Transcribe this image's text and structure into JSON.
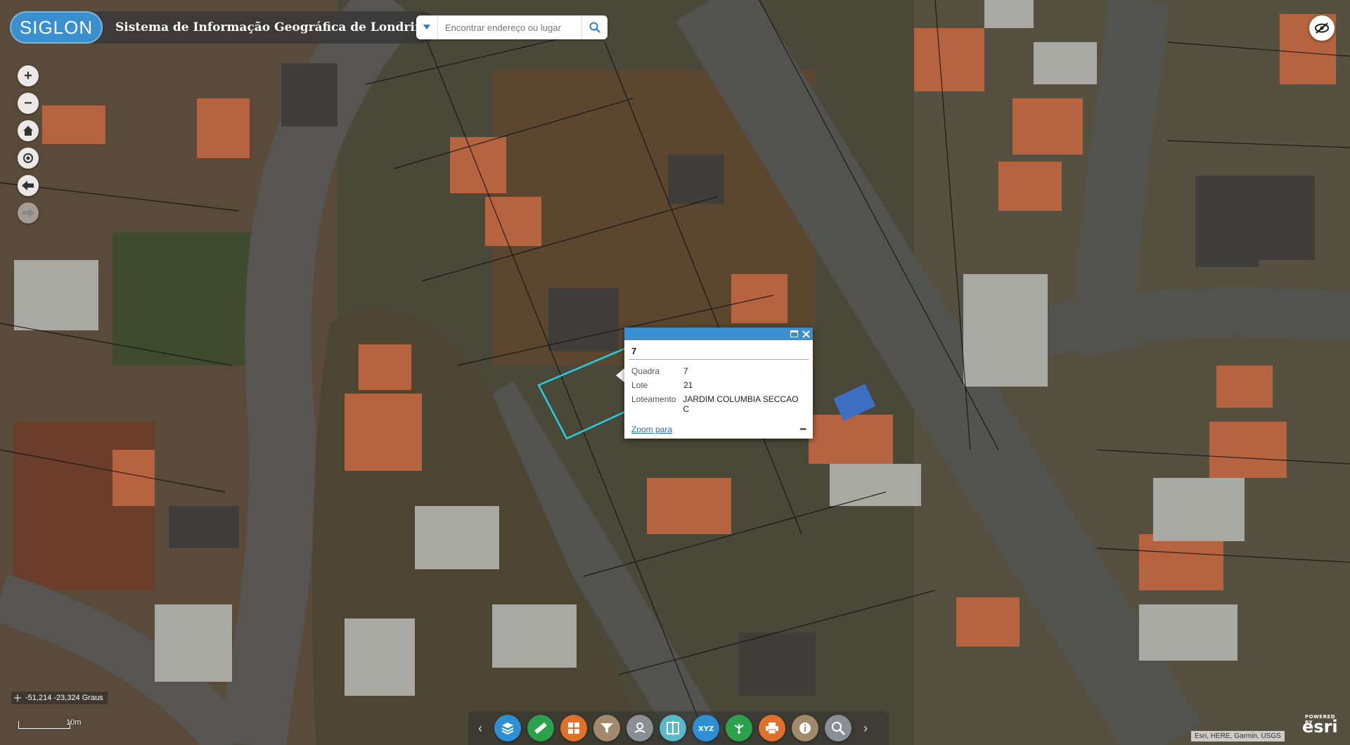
{
  "header": {
    "logo_text": "SIGLON",
    "title": "Sistema de Informação Geográfica de Londrina"
  },
  "search": {
    "placeholder": "Encontrar endereço ou lugar"
  },
  "map_tools": {
    "zoom_in": "+",
    "zoom_out": "−",
    "home": "home-icon",
    "locate": "locate-icon",
    "back": "back-icon",
    "forward": "forward-icon"
  },
  "popup": {
    "title": "7",
    "fields": [
      {
        "label": "Quadra",
        "value": "7"
      },
      {
        "label": "Lote",
        "value": "21"
      },
      {
        "label": "Loteamento",
        "value": "JARDIM COLUMBIA SECCAO C"
      }
    ],
    "zoom_link": "Zoom para",
    "more": "•••"
  },
  "coordinates": "-51,214 -23,324 Graus",
  "scale_label": "10m",
  "toolbar": {
    "buttons": [
      {
        "icon": "layers-icon",
        "color": "#2f8fd4"
      },
      {
        "icon": "ruler-icon",
        "color": "#2aa14a"
      },
      {
        "icon": "basemap-grid-icon",
        "color": "#e0702a"
      },
      {
        "icon": "filter-icon",
        "color": "#a08a6a"
      },
      {
        "icon": "directions-icon",
        "color": "#8a8f96"
      },
      {
        "icon": "swipe-icon",
        "color": "#5ab8c8"
      },
      {
        "icon": "xyz-coordinate-icon",
        "color": "#2f8fd4"
      },
      {
        "icon": "share-icon",
        "color": "#2aa14a"
      },
      {
        "icon": "print-icon",
        "color": "#e0702a"
      },
      {
        "icon": "info-icon",
        "color": "#a08a6a"
      },
      {
        "icon": "query-search-icon",
        "color": "#8a8f96"
      }
    ]
  },
  "attribution": "Esri, HERE, Garmin, USGS",
  "esri_powered": "POWERED BY",
  "esri_logo": "esri"
}
